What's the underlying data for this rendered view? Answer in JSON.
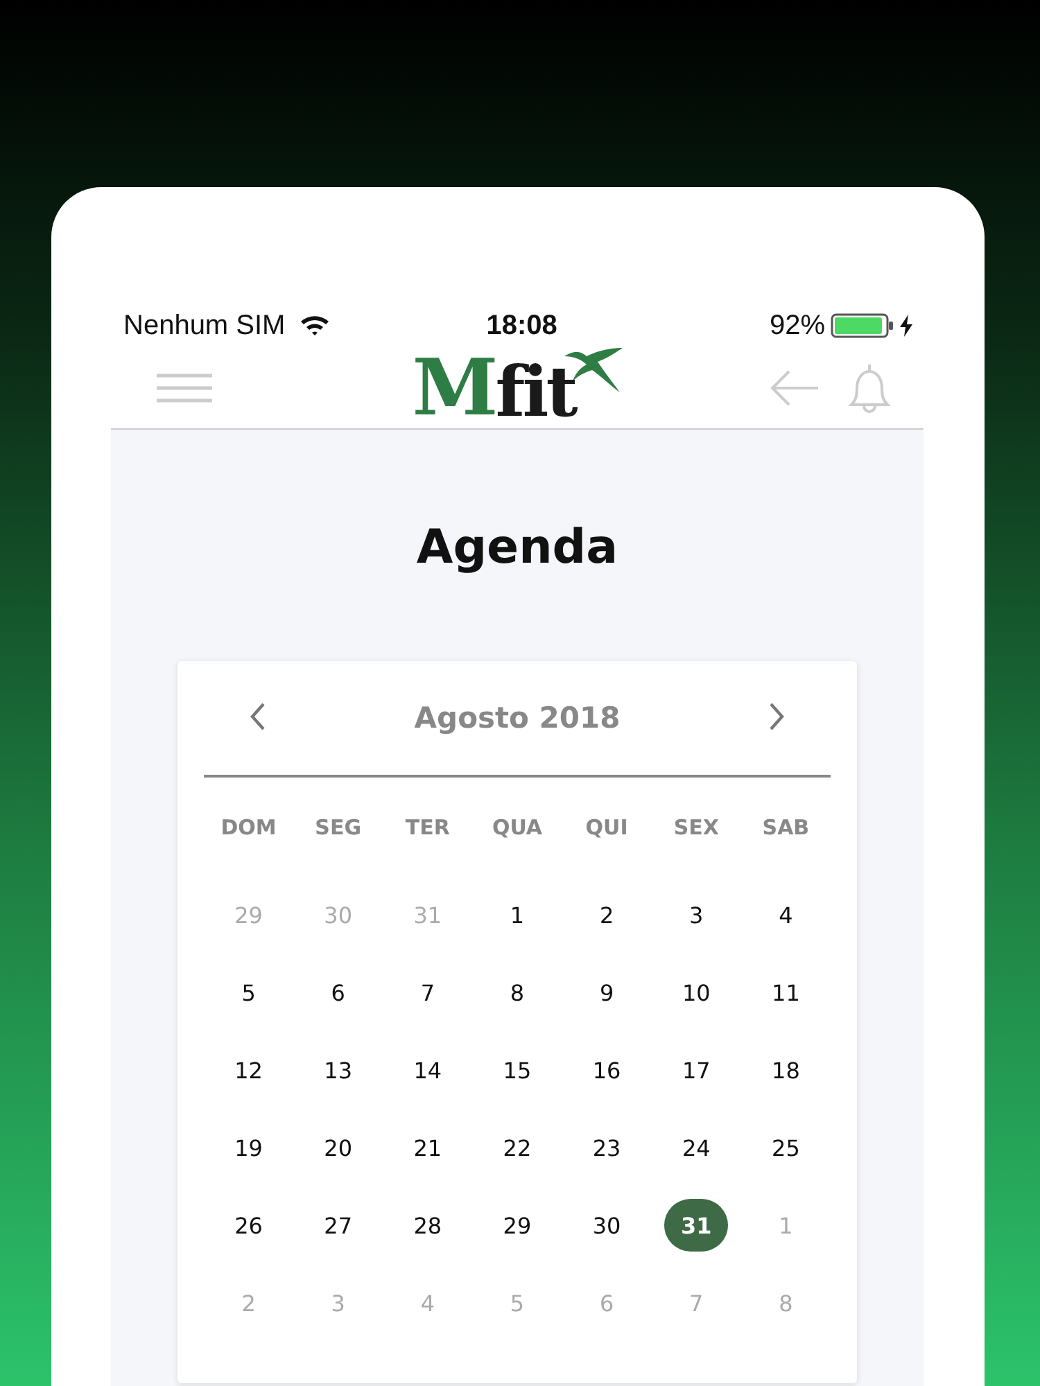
{
  "status_bar": {
    "carrier": "Nenhum SIM",
    "time": "18:08",
    "battery": "92%",
    "charging": true
  },
  "header": {
    "logo": {
      "initial": "M",
      "rest": "fit"
    }
  },
  "title": "Agenda",
  "calendar": {
    "month": "Agosto 2018",
    "weekdays": [
      "DOM",
      "SEG",
      "TER",
      "QUA",
      "QUI",
      "SEX",
      "SAB"
    ],
    "weeks": [
      [
        {
          "label": "29",
          "muted": true,
          "selected": false
        },
        {
          "label": "30",
          "muted": true,
          "selected": false
        },
        {
          "label": "31",
          "muted": true,
          "selected": false
        },
        {
          "label": "1",
          "muted": false,
          "selected": false
        },
        {
          "label": "2",
          "muted": false,
          "selected": false
        },
        {
          "label": "3",
          "muted": false,
          "selected": false
        },
        {
          "label": "4",
          "muted": false,
          "selected": false
        }
      ],
      [
        {
          "label": "5",
          "muted": false,
          "selected": false
        },
        {
          "label": "6",
          "muted": false,
          "selected": false
        },
        {
          "label": "7",
          "muted": false,
          "selected": false
        },
        {
          "label": "8",
          "muted": false,
          "selected": false
        },
        {
          "label": "9",
          "muted": false,
          "selected": false
        },
        {
          "label": "10",
          "muted": false,
          "selected": false
        },
        {
          "label": "11",
          "muted": false,
          "selected": false
        }
      ],
      [
        {
          "label": "12",
          "muted": false,
          "selected": false
        },
        {
          "label": "13",
          "muted": false,
          "selected": false
        },
        {
          "label": "14",
          "muted": false,
          "selected": false
        },
        {
          "label": "15",
          "muted": false,
          "selected": false
        },
        {
          "label": "16",
          "muted": false,
          "selected": false
        },
        {
          "label": "17",
          "muted": false,
          "selected": false
        },
        {
          "label": "18",
          "muted": false,
          "selected": false
        }
      ],
      [
        {
          "label": "19",
          "muted": false,
          "selected": false
        },
        {
          "label": "20",
          "muted": false,
          "selected": false
        },
        {
          "label": "21",
          "muted": false,
          "selected": false
        },
        {
          "label": "22",
          "muted": false,
          "selected": false
        },
        {
          "label": "23",
          "muted": false,
          "selected": false
        },
        {
          "label": "24",
          "muted": false,
          "selected": false
        },
        {
          "label": "25",
          "muted": false,
          "selected": false
        }
      ],
      [
        {
          "label": "26",
          "muted": false,
          "selected": false
        },
        {
          "label": "27",
          "muted": false,
          "selected": false
        },
        {
          "label": "28",
          "muted": false,
          "selected": false
        },
        {
          "label": "29",
          "muted": false,
          "selected": false
        },
        {
          "label": "30",
          "muted": false,
          "selected": false
        },
        {
          "label": "31",
          "muted": false,
          "selected": true
        },
        {
          "label": "1",
          "muted": true,
          "selected": false
        }
      ],
      [
        {
          "label": "2",
          "muted": true,
          "selected": false
        },
        {
          "label": "3",
          "muted": true,
          "selected": false
        },
        {
          "label": "4",
          "muted": true,
          "selected": false
        },
        {
          "label": "5",
          "muted": true,
          "selected": false
        },
        {
          "label": "6",
          "muted": true,
          "selected": false
        },
        {
          "label": "7",
          "muted": true,
          "selected": false
        },
        {
          "label": "8",
          "muted": true,
          "selected": false
        }
      ]
    ]
  }
}
